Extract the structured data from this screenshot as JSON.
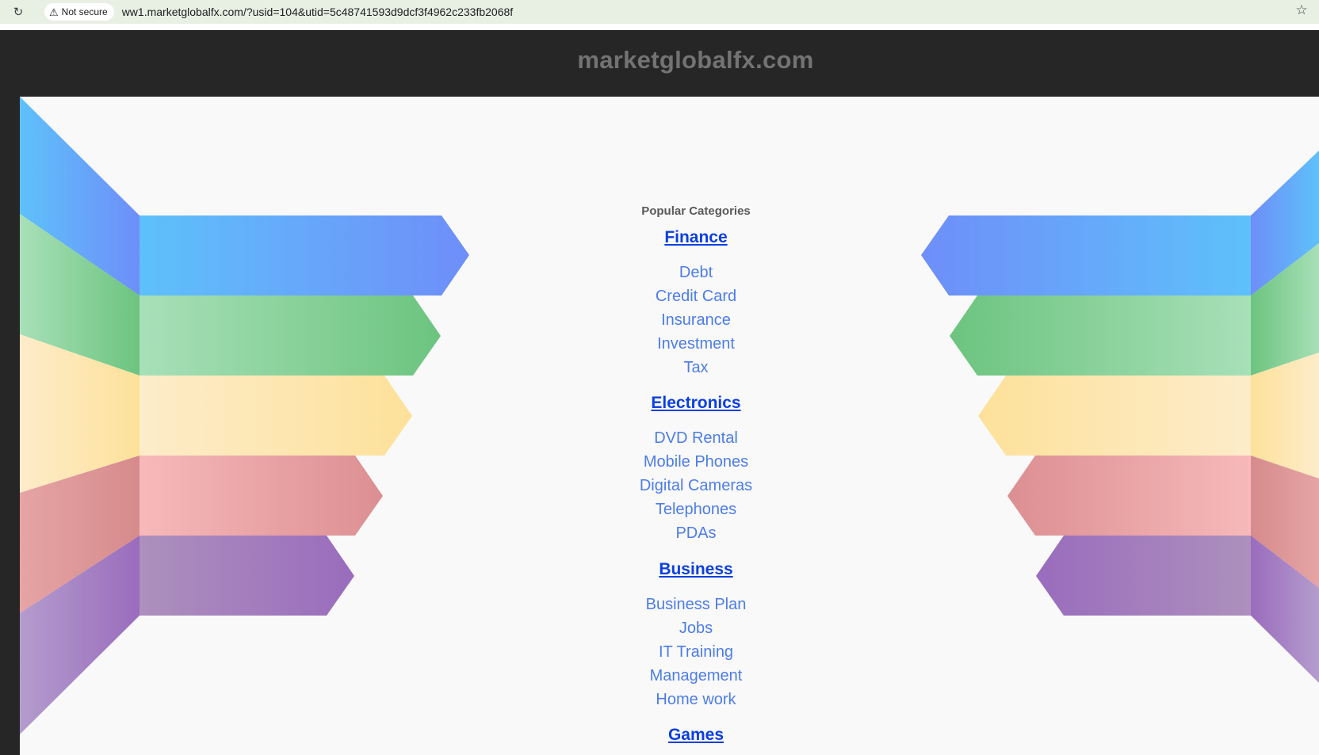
{
  "browser": {
    "reload_icon": "reload-icon",
    "security_label": "Not secure",
    "warning_icon": "warning-triangle-icon",
    "url": "ww1.marketglobalfx.com/?usid=104&utid=5c48741593d9dcf3f4962c233fb2068f",
    "bookmark_icon": "star-icon"
  },
  "header": {
    "site_name": "marketglobalfx.com"
  },
  "main": {
    "popular_title": "Popular Categories",
    "groups": [
      {
        "heading": "Finance",
        "links": [
          "Debt",
          "Credit Card",
          "Insurance",
          "Investment",
          "Tax"
        ]
      },
      {
        "heading": "Electronics",
        "links": [
          "DVD Rental",
          "Mobile Phones",
          "Digital Cameras",
          "Telephones",
          "PDAs"
        ]
      },
      {
        "heading": "Business",
        "links": [
          "Business Plan",
          "Jobs",
          "IT Training",
          "Management",
          "Home work"
        ]
      },
      {
        "heading": "Games",
        "links": []
      }
    ]
  },
  "colors": {
    "header_bg": "#262626",
    "site_name": "#737373",
    "heading_link": "#0b3fe0",
    "sub_link": "#4c7de8",
    "band_blue": "#5ec1fa",
    "band_green": "#6cc47f",
    "band_yellow": "#fde19a",
    "band_red": "#e3999a",
    "band_purple": "#a07cbd"
  }
}
